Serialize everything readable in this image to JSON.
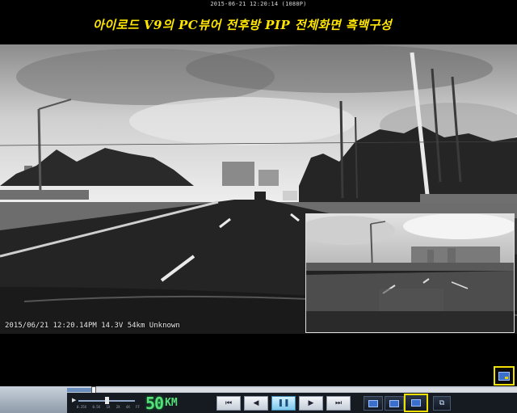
{
  "header": {
    "file_timestamp": "2015-06-21 12:20:14 (1080P)",
    "caption": "아이로드 V9의 PC뷰어 전후방 PIP 전체화면 흑백구성"
  },
  "video": {
    "osd_text": "2015/06/21 12:20.14PM 14.3V  54km Unknown"
  },
  "player": {
    "speed_value": "50",
    "speed_unit": "KM",
    "speed_ticks": [
      "0.25X",
      "0.5X",
      "1X",
      "2X",
      "4X",
      "FF"
    ],
    "seek_progress": 0.06,
    "playback_speed_level": 0.5,
    "buttons": {
      "first": "first-frame-icon",
      "prev": "step-back-icon",
      "play": "pause-icon",
      "next": "step-forward-icon",
      "last": "last-frame-icon",
      "view1": "single-view-icon",
      "view2": "dual-view-icon",
      "view3": "pip-view-icon",
      "detach": "detach-window-icon"
    }
  },
  "colors": {
    "caption": "#ffe600",
    "highlight": "#f0e000",
    "speed_digits": "#55e07a"
  }
}
